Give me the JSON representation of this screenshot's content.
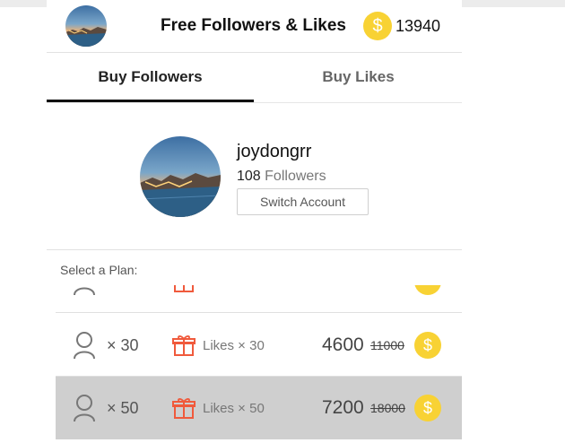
{
  "header": {
    "title": "Free Followers & Likes",
    "coin_symbol": "$",
    "coin_balance": "13940"
  },
  "tabs": [
    {
      "label": "Buy Followers",
      "active": true
    },
    {
      "label": "Buy Likes",
      "active": false
    }
  ],
  "profile": {
    "username": "joydongrr",
    "followers_count": "108",
    "followers_label": "Followers",
    "switch_account_label": "Switch Account"
  },
  "plan_section": {
    "label": "Select a Plan:",
    "plans": [
      {
        "count": "× 30",
        "likes": "Likes × 30",
        "price": "4600",
        "old_price": "11000",
        "coin_symbol": "$",
        "selected": false
      },
      {
        "count": "× 50",
        "likes": "Likes × 50",
        "price": "7200",
        "old_price": "18000",
        "coin_symbol": "$",
        "selected": true
      }
    ]
  },
  "colors": {
    "coin": "#f8d234",
    "gift": "#f05a3c",
    "selected_row": "#cfcfcf"
  },
  "icons": [
    "avatar-photo",
    "coin-icon",
    "person-icon",
    "gift-icon"
  ]
}
